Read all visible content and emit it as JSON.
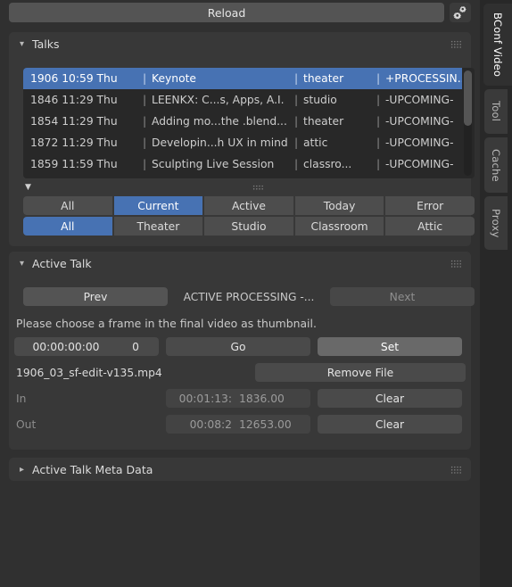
{
  "toolbar": {
    "reload_label": "Reload",
    "settings_icon": "gears-icon"
  },
  "talks_panel": {
    "title": "Talks",
    "expand_icon": "chevron-down-icon",
    "grip_icon": "grip-dots-icon",
    "filter_icon": "triangle-down-icon",
    "columns": [
      "id_time_day",
      "title",
      "room",
      "status"
    ],
    "rows": [
      {
        "id": "1906 10:59 Thu",
        "title": "Keynote",
        "room": "theater",
        "status": "+PROCESSIN...",
        "selected": true
      },
      {
        "id": "1846 11:29 Thu",
        "title": "LEENKX: C...s, Apps, A.I.",
        "room": "studio",
        "status": "-UPCOMING-",
        "selected": false
      },
      {
        "id": "1854 11:29 Thu",
        "title": "Adding mo...the .blend...",
        "room": "theater",
        "status": "-UPCOMING-",
        "selected": false
      },
      {
        "id": "1872 11:29 Thu",
        "title": "Developin...h UX in mind",
        "room": "attic",
        "status": "-UPCOMING-",
        "selected": false
      },
      {
        "id": "1859 11:59 Thu",
        "title": "Sculpting Live Session",
        "room": "classro...",
        "status": "-UPCOMING-",
        "selected": false
      }
    ],
    "filter_state": [
      {
        "label": "All",
        "active": false
      },
      {
        "label": "Current",
        "active": true
      },
      {
        "label": "Active",
        "active": false
      },
      {
        "label": "Today",
        "active": false
      },
      {
        "label": "Error",
        "active": false
      }
    ],
    "filter_room": [
      {
        "label": "All",
        "active": true
      },
      {
        "label": "Theater",
        "active": false
      },
      {
        "label": "Studio",
        "active": false
      },
      {
        "label": "Classroom",
        "active": false
      },
      {
        "label": "Attic",
        "active": false
      }
    ]
  },
  "active_talk": {
    "title": "Active Talk",
    "expand_icon": "chevron-down-icon",
    "grip_icon": "grip-dots-icon",
    "prev_label": "Prev",
    "status_label": "ACTIVE PROCESSING -...",
    "next_label": "Next",
    "hint": "Please choose a frame in the final video as thumbnail.",
    "frame_timecode": "00:00:00:00",
    "frame_number": "0",
    "go_label": "Go",
    "set_label": "Set",
    "file_name": "1906_03_sf-edit-v135.mp4",
    "remove_file_label": "Remove File",
    "in_label": "In",
    "in_timecode": "00:01:13:",
    "in_frame": "1836.00",
    "in_clear_label": "Clear",
    "out_label": "Out",
    "out_timecode": "00:08:2",
    "out_frame": "12653.00",
    "out_clear_label": "Clear"
  },
  "meta_panel": {
    "title": "Active Talk Meta Data",
    "expand_icon": "chevron-right-icon",
    "grip_icon": "grip-dots-icon"
  },
  "tabs": [
    {
      "label": "BConf Video",
      "active": true
    },
    {
      "label": "Tool",
      "active": false
    },
    {
      "label": "Cache",
      "active": false
    },
    {
      "label": "Proxy",
      "active": false
    }
  ],
  "colors": {
    "accent": "#4772b3",
    "panel": "#383838",
    "background": "#303030",
    "list_background": "#282828"
  }
}
